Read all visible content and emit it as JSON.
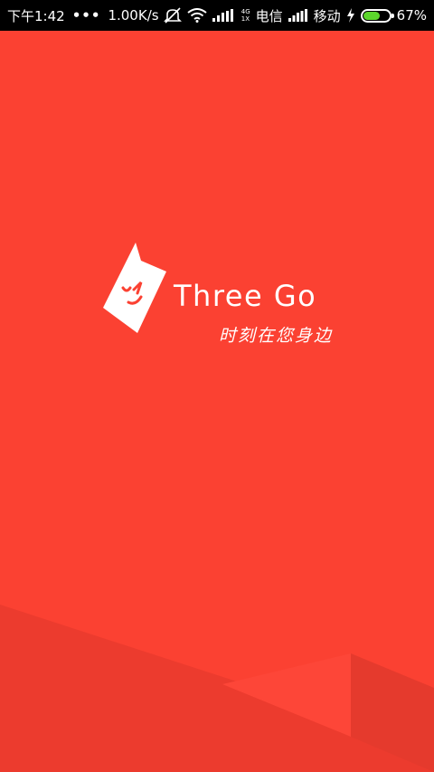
{
  "status_bar": {
    "time": "下午1:42",
    "dots": "•••",
    "speed": "1.00K/s",
    "net_type_top": "4G",
    "net_type_bottom": "1X",
    "carrier1": "电信",
    "carrier2": "移动",
    "battery_percent": "67%",
    "battery_level": 0.67,
    "icons": [
      "mute-icon",
      "wifi-icon",
      "signal-icon",
      "signal-icon",
      "charging-icon",
      "battery-icon"
    ]
  },
  "splash": {
    "brand_name": "Three Go",
    "slogan": "时刻在您身边",
    "logo_icon": "three-go-logo-icon",
    "colors": {
      "background": "#fb4132",
      "accent_dark": "#e93a2f",
      "accent_light": "#ff4a3b",
      "text": "#ffffff"
    }
  }
}
